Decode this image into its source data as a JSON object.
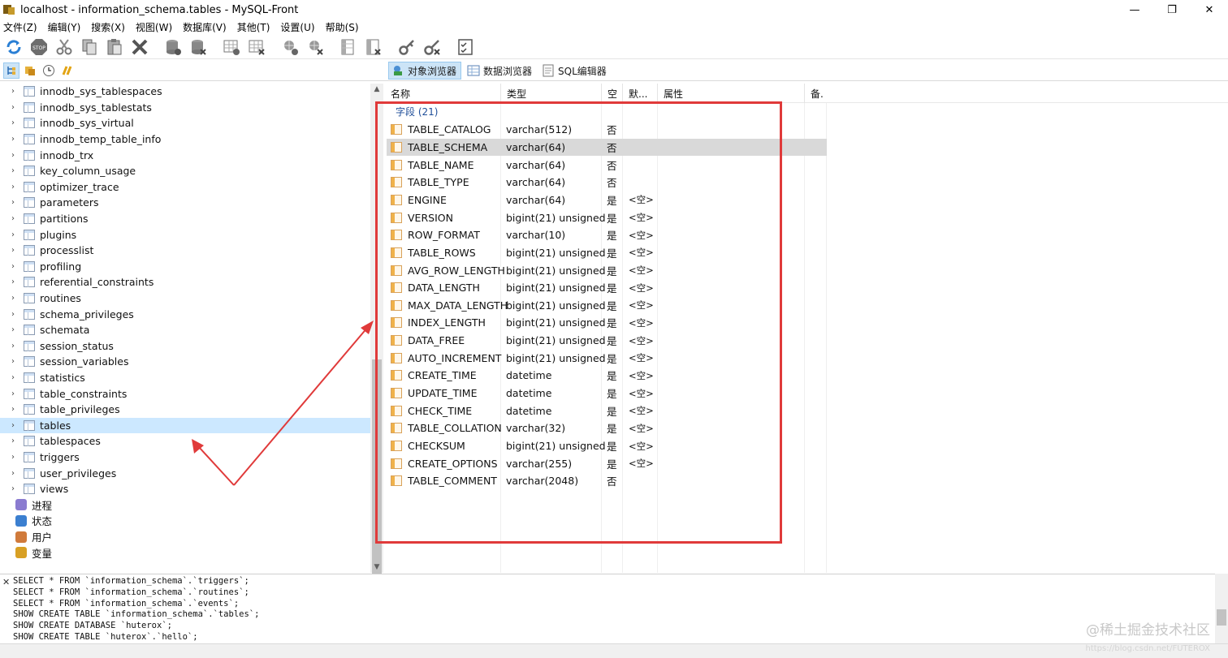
{
  "window": {
    "title": "localhost - information_schema.tables - MySQL-Front",
    "controls": {
      "minimize": "—",
      "maximize": "❐",
      "close": "✕"
    }
  },
  "menu": [
    "文件(Z)",
    "编辑(Y)",
    "搜索(X)",
    "视图(W)",
    "数据库(V)",
    "其他(T)",
    "设置(U)",
    "帮助(S)"
  ],
  "toolbar_icons": [
    "refresh-icon",
    "stop-icon",
    "cut-icon",
    "copy-icon",
    "paste-icon",
    "delete-icon",
    "database-add-icon",
    "database-delete-icon",
    "table-add-icon",
    "table-delete-icon",
    "user-add-icon",
    "user-delete-icon",
    "column-add-icon",
    "column-delete-icon",
    "key-icon",
    "key-delete-icon",
    "checklist-icon"
  ],
  "view_tabs": [
    {
      "label": "对象浏览器",
      "active": true
    },
    {
      "label": "数据浏览器",
      "active": false
    },
    {
      "label": "SQL编辑器",
      "active": false
    }
  ],
  "tree": {
    "tables": [
      "innodb_sys_tablespaces",
      "innodb_sys_tablestats",
      "innodb_sys_virtual",
      "innodb_temp_table_info",
      "innodb_trx",
      "key_column_usage",
      "optimizer_trace",
      "parameters",
      "partitions",
      "plugins",
      "processlist",
      "profiling",
      "referential_constraints",
      "routines",
      "schema_privileges",
      "schemata",
      "session_status",
      "session_variables",
      "statistics",
      "table_constraints",
      "table_privileges",
      "tables",
      "tablespaces",
      "triggers",
      "user_privileges",
      "views"
    ],
    "selected": "tables",
    "misc": [
      {
        "label": "进程",
        "icon": "process-icon",
        "color": "#8a7bd0"
      },
      {
        "label": "状态",
        "icon": "status-icon",
        "color": "#3b7fd0"
      },
      {
        "label": "用户",
        "icon": "users-icon",
        "color": "#d07a3b"
      },
      {
        "label": "变量",
        "icon": "variables-icon",
        "color": "#d8a024"
      }
    ]
  },
  "grid": {
    "headers": [
      "名称",
      "类型",
      "空",
      "默...",
      "属性",
      "备."
    ],
    "group_label": "字段 (21)",
    "rows": [
      {
        "name": "TABLE_CATALOG",
        "type": "varchar(512)",
        "null": "否",
        "default": ""
      },
      {
        "name": "TABLE_SCHEMA",
        "type": "varchar(64)",
        "null": "否",
        "default": ""
      },
      {
        "name": "TABLE_NAME",
        "type": "varchar(64)",
        "null": "否",
        "default": ""
      },
      {
        "name": "TABLE_TYPE",
        "type": "varchar(64)",
        "null": "否",
        "default": ""
      },
      {
        "name": "ENGINE",
        "type": "varchar(64)",
        "null": "是",
        "default": "<空>"
      },
      {
        "name": "VERSION",
        "type": "bigint(21) unsigned",
        "null": "是",
        "default": "<空>"
      },
      {
        "name": "ROW_FORMAT",
        "type": "varchar(10)",
        "null": "是",
        "default": "<空>"
      },
      {
        "name": "TABLE_ROWS",
        "type": "bigint(21) unsigned",
        "null": "是",
        "default": "<空>"
      },
      {
        "name": "AVG_ROW_LENGTH",
        "type": "bigint(21) unsigned",
        "null": "是",
        "default": "<空>"
      },
      {
        "name": "DATA_LENGTH",
        "type": "bigint(21) unsigned",
        "null": "是",
        "default": "<空>"
      },
      {
        "name": "MAX_DATA_LENGTH",
        "type": "bigint(21) unsigned",
        "null": "是",
        "default": "<空>"
      },
      {
        "name": "INDEX_LENGTH",
        "type": "bigint(21) unsigned",
        "null": "是",
        "default": "<空>"
      },
      {
        "name": "DATA_FREE",
        "type": "bigint(21) unsigned",
        "null": "是",
        "default": "<空>"
      },
      {
        "name": "AUTO_INCREMENT",
        "type": "bigint(21) unsigned",
        "null": "是",
        "default": "<空>"
      },
      {
        "name": "CREATE_TIME",
        "type": "datetime",
        "null": "是",
        "default": "<空>"
      },
      {
        "name": "UPDATE_TIME",
        "type": "datetime",
        "null": "是",
        "default": "<空>"
      },
      {
        "name": "CHECK_TIME",
        "type": "datetime",
        "null": "是",
        "default": "<空>"
      },
      {
        "name": "TABLE_COLLATION",
        "type": "varchar(32)",
        "null": "是",
        "default": "<空>"
      },
      {
        "name": "CHECKSUM",
        "type": "bigint(21) unsigned",
        "null": "是",
        "default": "<空>"
      },
      {
        "name": "CREATE_OPTIONS",
        "type": "varchar(255)",
        "null": "是",
        "default": "<空>"
      },
      {
        "name": "TABLE_COMMENT",
        "type": "varchar(2048)",
        "null": "否",
        "default": ""
      }
    ],
    "highlighted_row": "TABLE_SCHEMA"
  },
  "sql_log": {
    "close": "✕",
    "lines": [
      "SELECT * FROM `information_schema`.`triggers`;",
      "SELECT * FROM `information_schema`.`routines`;",
      "SELECT * FROM `information_schema`.`events`;",
      "SHOW CREATE TABLE `information_schema`.`tables`;",
      "SHOW CREATE DATABASE `huterox`;",
      "SHOW CREATE TABLE `huterox`.`hello`;"
    ]
  },
  "watermark": "@稀土掘金技术社区",
  "watermark_url": "https://blog.csdn.net/FUTEROX",
  "colors": {
    "annotation_red": "#e03a3a",
    "selection_blue": "#cce8ff",
    "group_blue": "#1f4e99"
  }
}
